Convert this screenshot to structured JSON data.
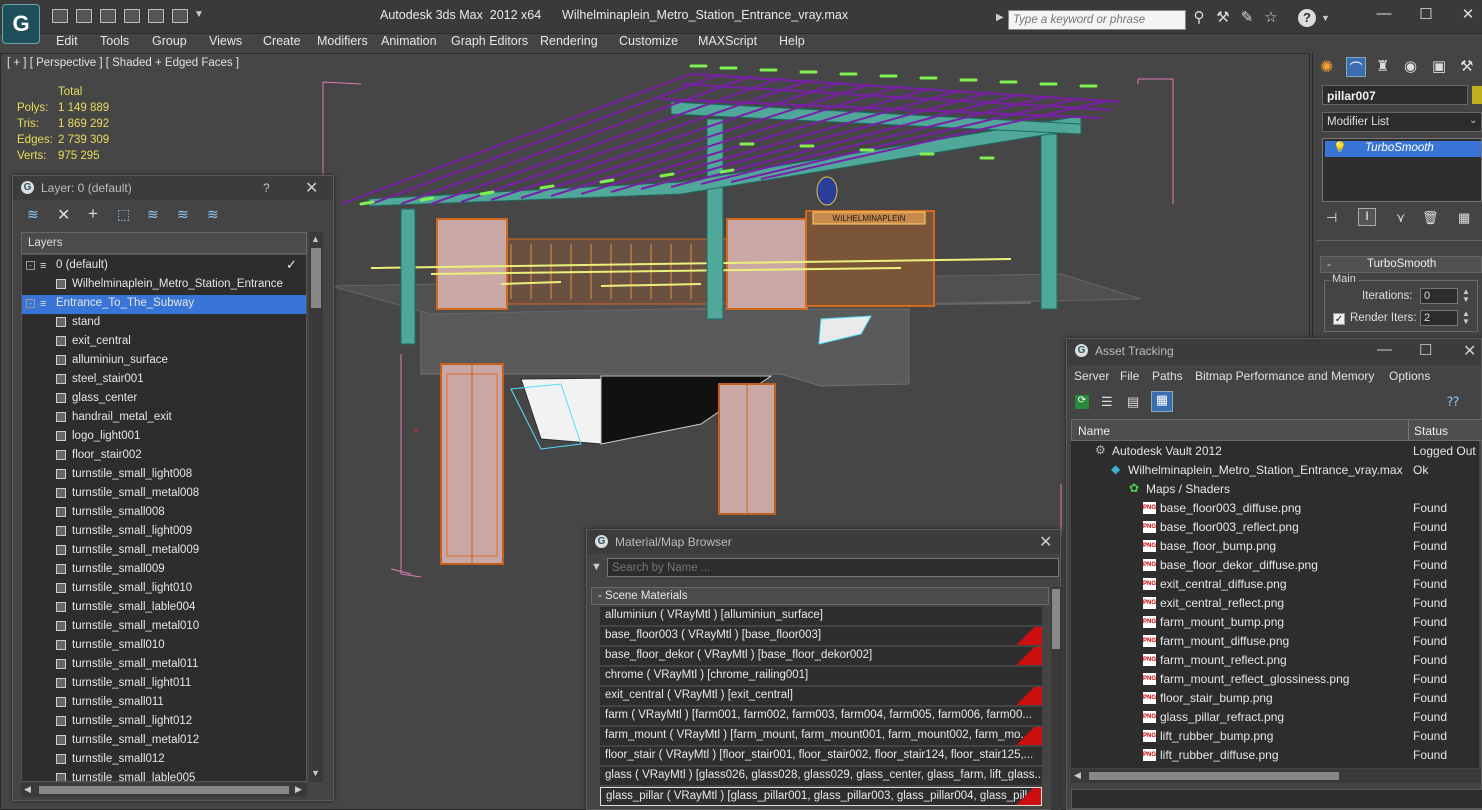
{
  "title": "Autodesk 3ds Max  2012 x64      Wilhelminaplein_Metro_Station_Entrance_vray.max",
  "search": {
    "placeholder": "Type a keyword or phrase"
  },
  "menu": [
    "Edit",
    "Tools",
    "Group",
    "Views",
    "Create",
    "Modifiers",
    "Animation",
    "Graph Editors",
    "Rendering",
    "Customize",
    "MAXScript",
    "Help"
  ],
  "viewport": {
    "label": "[ + ] [ Perspective ] [ Shaded + Edged Faces ]",
    "stats_header": "Total",
    "stats": [
      {
        "label": "Polys:",
        "value": "1 149 889"
      },
      {
        "label": "Tris:",
        "value": "1 869 292"
      },
      {
        "label": "Edges:",
        "value": "2 739 309"
      },
      {
        "label": "Verts:",
        "value": "975 295"
      }
    ],
    "sign_text": "WILHELMINAPLEIN"
  },
  "layer_window": {
    "title": "Layer: 0 (default)",
    "help": "?",
    "column": "Layers",
    "layers": [
      {
        "name": "0 (default)",
        "level": 0,
        "type": "layer"
      },
      {
        "name": "Wilhelminaplein_Metro_Station_Entrance",
        "level": 1,
        "type": "object"
      },
      {
        "name": "Entrance_To_The_Subway",
        "level": 0,
        "type": "layer",
        "selected": true
      },
      {
        "name": "stand",
        "level": 1,
        "type": "object"
      },
      {
        "name": "exit_central",
        "level": 1,
        "type": "object"
      },
      {
        "name": "alluminiun_surface",
        "level": 1,
        "type": "object"
      },
      {
        "name": "steel_stair001",
        "level": 1,
        "type": "object"
      },
      {
        "name": "glass_center",
        "level": 1,
        "type": "object"
      },
      {
        "name": "handrail_metal_exit",
        "level": 1,
        "type": "object"
      },
      {
        "name": "logo_light001",
        "level": 1,
        "type": "object"
      },
      {
        "name": "floor_stair002",
        "level": 1,
        "type": "object"
      },
      {
        "name": "turnstile_small_light008",
        "level": 1,
        "type": "object"
      },
      {
        "name": "turnstile_small_metal008",
        "level": 1,
        "type": "object"
      },
      {
        "name": "turnstile_small008",
        "level": 1,
        "type": "object"
      },
      {
        "name": "turnstile_small_light009",
        "level": 1,
        "type": "object"
      },
      {
        "name": "turnstile_small_metal009",
        "level": 1,
        "type": "object"
      },
      {
        "name": "turnstile_small009",
        "level": 1,
        "type": "object"
      },
      {
        "name": "turnstile_small_light010",
        "level": 1,
        "type": "object"
      },
      {
        "name": "turnstile_small_lable004",
        "level": 1,
        "type": "object"
      },
      {
        "name": "turnstile_small_metal010",
        "level": 1,
        "type": "object"
      },
      {
        "name": "turnstile_small010",
        "level": 1,
        "type": "object"
      },
      {
        "name": "turnstile_small_metal011",
        "level": 1,
        "type": "object"
      },
      {
        "name": "turnstile_small_light011",
        "level": 1,
        "type": "object"
      },
      {
        "name": "turnstile_small011",
        "level": 1,
        "type": "object"
      },
      {
        "name": "turnstile_small_light012",
        "level": 1,
        "type": "object"
      },
      {
        "name": "turnstile_small_metal012",
        "level": 1,
        "type": "object"
      },
      {
        "name": "turnstile_small012",
        "level": 1,
        "type": "object"
      },
      {
        "name": "turnstile_small_lable005",
        "level": 1,
        "type": "object"
      }
    ]
  },
  "material_browser": {
    "title": "Material/Map Browser",
    "search_placeholder": "Search by Name ...",
    "group": "- Scene Materials",
    "materials": [
      {
        "text": "alluminiun  ( VRayMtl )  [alluminiun_surface]",
        "swatch": "none"
      },
      {
        "text": "base_floor003  ( VRayMtl ) [base_floor003]",
        "swatch": "red"
      },
      {
        "text": "base_floor_dekor  ( VRayMtl ) [base_floor_dekor002]",
        "swatch": "red"
      },
      {
        "text": "chrome  ( VRayMtl ) [chrome_railing001]",
        "swatch": "none"
      },
      {
        "text": "exit_central  ( VRayMtl )  [exit_central]",
        "swatch": "red"
      },
      {
        "text": "farm   ( VRayMtl )  [farm001, farm002, farm003, farm004, farm005, farm006, farm00...",
        "swatch": "none"
      },
      {
        "text": "farm_mount  ( VRayMtl )  [farm_mount, farm_mount001, farm_mount002, farm_mo...",
        "swatch": "red"
      },
      {
        "text": "floor_stair ( VRayMtl ) [floor_stair001, floor_stair002, floor_stair124, floor_stair125,...",
        "swatch": "none"
      },
      {
        "text": "glass ( VRayMtl ) [glass026, glass028, glass029, glass_center, glass_farm, lift_glass...",
        "swatch": "none"
      },
      {
        "text": "glass_pillar ( VRayMtl ) [glass_pillar001, glass_pillar003, glass_pillar004, glass_pilla...",
        "swatch": "red",
        "selected": true
      }
    ]
  },
  "asset_tracking": {
    "title": "Asset Tracking",
    "menu": [
      "Server",
      "File",
      "Paths",
      "Bitmap Performance and Memory",
      "Options"
    ],
    "columns": {
      "name": "Name",
      "status": "Status"
    },
    "rows": [
      {
        "name": "Autodesk Vault 2012",
        "status": "Logged Out",
        "level": 0,
        "icon": "vault"
      },
      {
        "name": "Wilhelminaplein_Metro_Station_Entrance_vray.max",
        "status": "Ok",
        "level": 1,
        "icon": "max"
      },
      {
        "name": "Maps / Shaders",
        "status": "",
        "level": 2,
        "icon": "maps"
      },
      {
        "name": "base_floor003_diffuse.png",
        "status": "Found",
        "level": 3,
        "icon": "png"
      },
      {
        "name": "base_floor003_reflect.png",
        "status": "Found",
        "level": 3,
        "icon": "png"
      },
      {
        "name": "base_floor_bump.png",
        "status": "Found",
        "level": 3,
        "icon": "png"
      },
      {
        "name": "base_floor_dekor_diffuse.png",
        "status": "Found",
        "level": 3,
        "icon": "png"
      },
      {
        "name": "exit_central_diffuse.png",
        "status": "Found",
        "level": 3,
        "icon": "png"
      },
      {
        "name": "exit_central_reflect.png",
        "status": "Found",
        "level": 3,
        "icon": "png"
      },
      {
        "name": "farm_mount_bump.png",
        "status": "Found",
        "level": 3,
        "icon": "png"
      },
      {
        "name": "farm_mount_diffuse.png",
        "status": "Found",
        "level": 3,
        "icon": "png"
      },
      {
        "name": "farm_mount_reflect.png",
        "status": "Found",
        "level": 3,
        "icon": "png"
      },
      {
        "name": "farm_mount_reflect_glossiness.png",
        "status": "Found",
        "level": 3,
        "icon": "png"
      },
      {
        "name": "floor_stair_bump.png",
        "status": "Found",
        "level": 3,
        "icon": "png"
      },
      {
        "name": "glass_pillar_refract.png",
        "status": "Found",
        "level": 3,
        "icon": "png"
      },
      {
        "name": "lift_rubber_bump.png",
        "status": "Found",
        "level": 3,
        "icon": "png"
      },
      {
        "name": "lift_rubber_diffuse.png",
        "status": "Found",
        "level": 3,
        "icon": "png"
      }
    ]
  },
  "command_panel": {
    "object_name": "pillar007",
    "modifier_list": "Modifier List",
    "stack_item": "TurboSmooth",
    "rollout_title": "TurboSmooth",
    "group": "Main",
    "iterations_label": "Iterations:",
    "iterations_value": "0",
    "render_iters_label": "Render Iters:",
    "render_iters_value": "2",
    "render_iters_checked": true
  },
  "colors": {
    "roof_purple": "#7a1fa8",
    "teal": "#3aa596",
    "orange": "#d2691e",
    "selection_blue": "#3875d7",
    "swatch_red": "#cc1010"
  }
}
